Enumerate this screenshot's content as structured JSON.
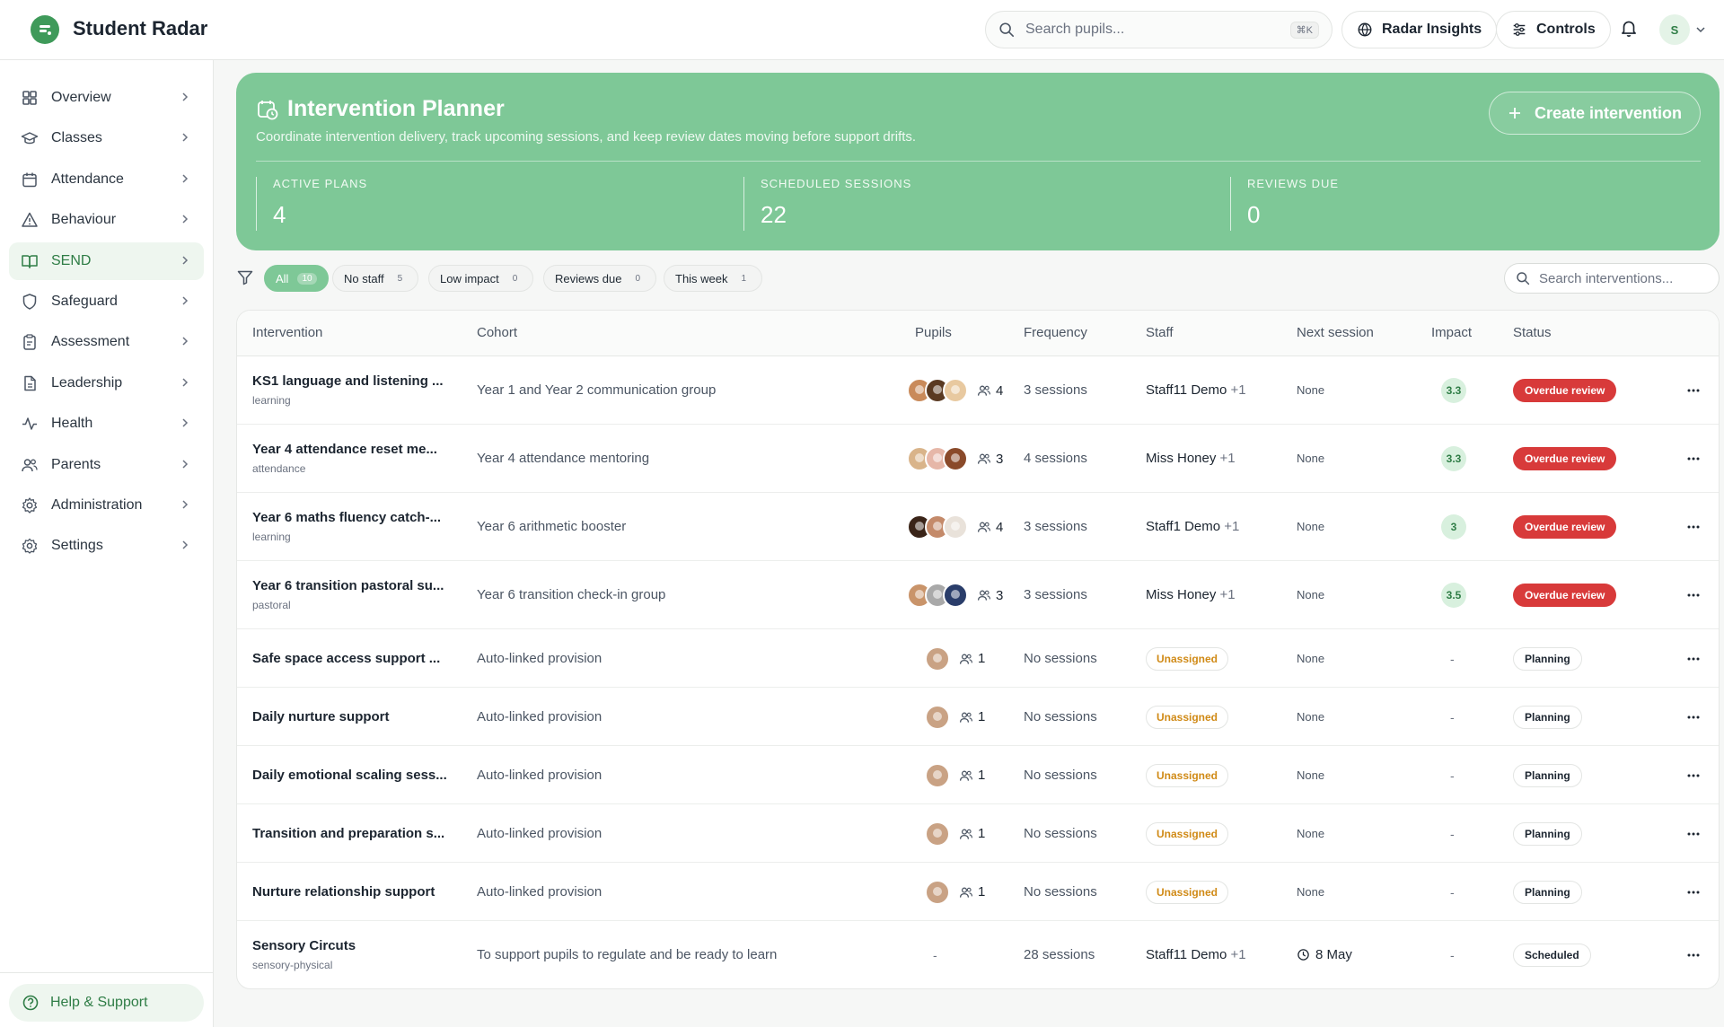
{
  "app": {
    "title": "Student Radar"
  },
  "topbar": {
    "search_placeholder": "Search pupils...",
    "search_shortcut": "⌘K",
    "insights_label": "Radar Insights",
    "controls_label": "Controls",
    "avatar_initial": "S"
  },
  "sidebar": {
    "items": [
      {
        "label": "Overview",
        "icon": "grid-icon"
      },
      {
        "label": "Classes",
        "icon": "graduation-cap-icon"
      },
      {
        "label": "Attendance",
        "icon": "calendar-icon"
      },
      {
        "label": "Behaviour",
        "icon": "warning-triangle-icon"
      },
      {
        "label": "SEND",
        "icon": "book-open-icon",
        "active": true
      },
      {
        "label": "Safeguard",
        "icon": "shield-icon"
      },
      {
        "label": "Assessment",
        "icon": "clipboard-icon"
      },
      {
        "label": "Leadership",
        "icon": "document-icon"
      },
      {
        "label": "Health",
        "icon": "activity-icon"
      },
      {
        "label": "Parents",
        "icon": "users-icon"
      },
      {
        "label": "Administration",
        "icon": "cog-icon"
      },
      {
        "label": "Settings",
        "icon": "settings-icon"
      }
    ],
    "help_label": "Help & Support"
  },
  "hero": {
    "title": "Intervention Planner",
    "subtitle": "Coordinate intervention delivery, track upcoming sessions, and keep review dates moving before support drifts.",
    "create_label": "Create intervention",
    "stats": [
      {
        "label": "ACTIVE PLANS",
        "value": "4"
      },
      {
        "label": "SCHEDULED SESSIONS",
        "value": "22"
      },
      {
        "label": "REVIEWS DUE",
        "value": "0"
      }
    ]
  },
  "filters": {
    "chips": [
      {
        "label": "All",
        "count": "10",
        "active": true
      },
      {
        "label": "No staff",
        "count": "5"
      },
      {
        "label": "Low impact",
        "count": "0"
      },
      {
        "label": "Reviews due",
        "count": "0"
      },
      {
        "label": "This week",
        "count": "1"
      }
    ],
    "search_placeholder": "Search interventions..."
  },
  "table": {
    "columns": [
      "Intervention",
      "Cohort",
      "Pupils",
      "Frequency",
      "Staff",
      "Next session",
      "Impact",
      "Status"
    ],
    "rows": [
      {
        "name": "KS1 language and listening ...",
        "sub": "learning",
        "cohort": "Year 1 and Year 2 communication group",
        "pupils": "4",
        "faces": [
          "#c98a5a",
          "#5a3a22",
          "#e8c9a0"
        ],
        "frequency": "3 sessions",
        "staff": "Staff11 Demo",
        "staff_extra": "+1",
        "next": "None",
        "impact": "3.3",
        "status": "Overdue review",
        "status_type": "overdue"
      },
      {
        "name": "Year 4 attendance reset me...",
        "sub": "attendance",
        "cohort": "Year 4 attendance mentoring",
        "pupils": "3",
        "faces": [
          "#d9b48a",
          "#e6b7a8",
          "#8a4a2a"
        ],
        "frequency": "4 sessions",
        "staff": "Miss Honey",
        "staff_extra": "+1",
        "next": "None",
        "impact": "3.3",
        "status": "Overdue review",
        "status_type": "overdue"
      },
      {
        "name": "Year 6 maths fluency catch-...",
        "sub": "learning",
        "cohort": "Year 6 arithmetic booster",
        "pupils": "4",
        "faces": [
          "#3a2418",
          "#c48a6a",
          "#e9e2da"
        ],
        "frequency": "3 sessions",
        "staff": "Staff1 Demo",
        "staff_extra": "+1",
        "next": "None",
        "impact": "3",
        "status": "Overdue review",
        "status_type": "overdue"
      },
      {
        "name": "Year 6 transition pastoral su...",
        "sub": "pastoral",
        "cohort": "Year 6 transition check-in group",
        "pupils": "3",
        "faces": [
          "#c9946a",
          "#a9a9a9",
          "#2a3d6a"
        ],
        "frequency": "3 sessions",
        "staff": "Miss Honey",
        "staff_extra": "+1",
        "next": "None",
        "impact": "3.5",
        "status": "Overdue review",
        "status_type": "overdue"
      },
      {
        "name": "Safe space access support ...",
        "sub": "",
        "cohort": "Auto-linked provision",
        "pupils": "1",
        "faces": [
          "#c9a284"
        ],
        "frequency": "No sessions",
        "staff": "Unassigned",
        "staff_extra": "",
        "next": "None",
        "impact": "-",
        "status": "Planning",
        "status_type": "planning"
      },
      {
        "name": "Daily nurture support",
        "sub": "",
        "cohort": "Auto-linked provision",
        "pupils": "1",
        "faces": [
          "#c9a284"
        ],
        "frequency": "No sessions",
        "staff": "Unassigned",
        "staff_extra": "",
        "next": "None",
        "impact": "-",
        "status": "Planning",
        "status_type": "planning"
      },
      {
        "name": "Daily emotional scaling sess...",
        "sub": "",
        "cohort": "Auto-linked provision",
        "pupils": "1",
        "faces": [
          "#c9a284"
        ],
        "frequency": "No sessions",
        "staff": "Unassigned",
        "staff_extra": "",
        "next": "None",
        "impact": "-",
        "status": "Planning",
        "status_type": "planning"
      },
      {
        "name": "Transition and preparation s...",
        "sub": "",
        "cohort": "Auto-linked provision",
        "pupils": "1",
        "faces": [
          "#c9a284"
        ],
        "frequency": "No sessions",
        "staff": "Unassigned",
        "staff_extra": "",
        "next": "None",
        "impact": "-",
        "status": "Planning",
        "status_type": "planning"
      },
      {
        "name": "Nurture relationship support",
        "sub": "",
        "cohort": "Auto-linked provision",
        "pupils": "1",
        "faces": [
          "#c9a284"
        ],
        "frequency": "No sessions",
        "staff": "Unassigned",
        "staff_extra": "",
        "next": "None",
        "impact": "-",
        "status": "Planning",
        "status_type": "planning"
      },
      {
        "name": "Sensory Circuts",
        "sub": "sensory-physical",
        "cohort": "To support pupils to regulate and be ready to learn",
        "pupils": "-",
        "faces": [],
        "frequency": "28 sessions",
        "staff": "Staff11 Demo",
        "staff_extra": "+1",
        "next": "8 May",
        "impact": "-",
        "status": "Scheduled",
        "status_type": "scheduled"
      }
    ]
  }
}
